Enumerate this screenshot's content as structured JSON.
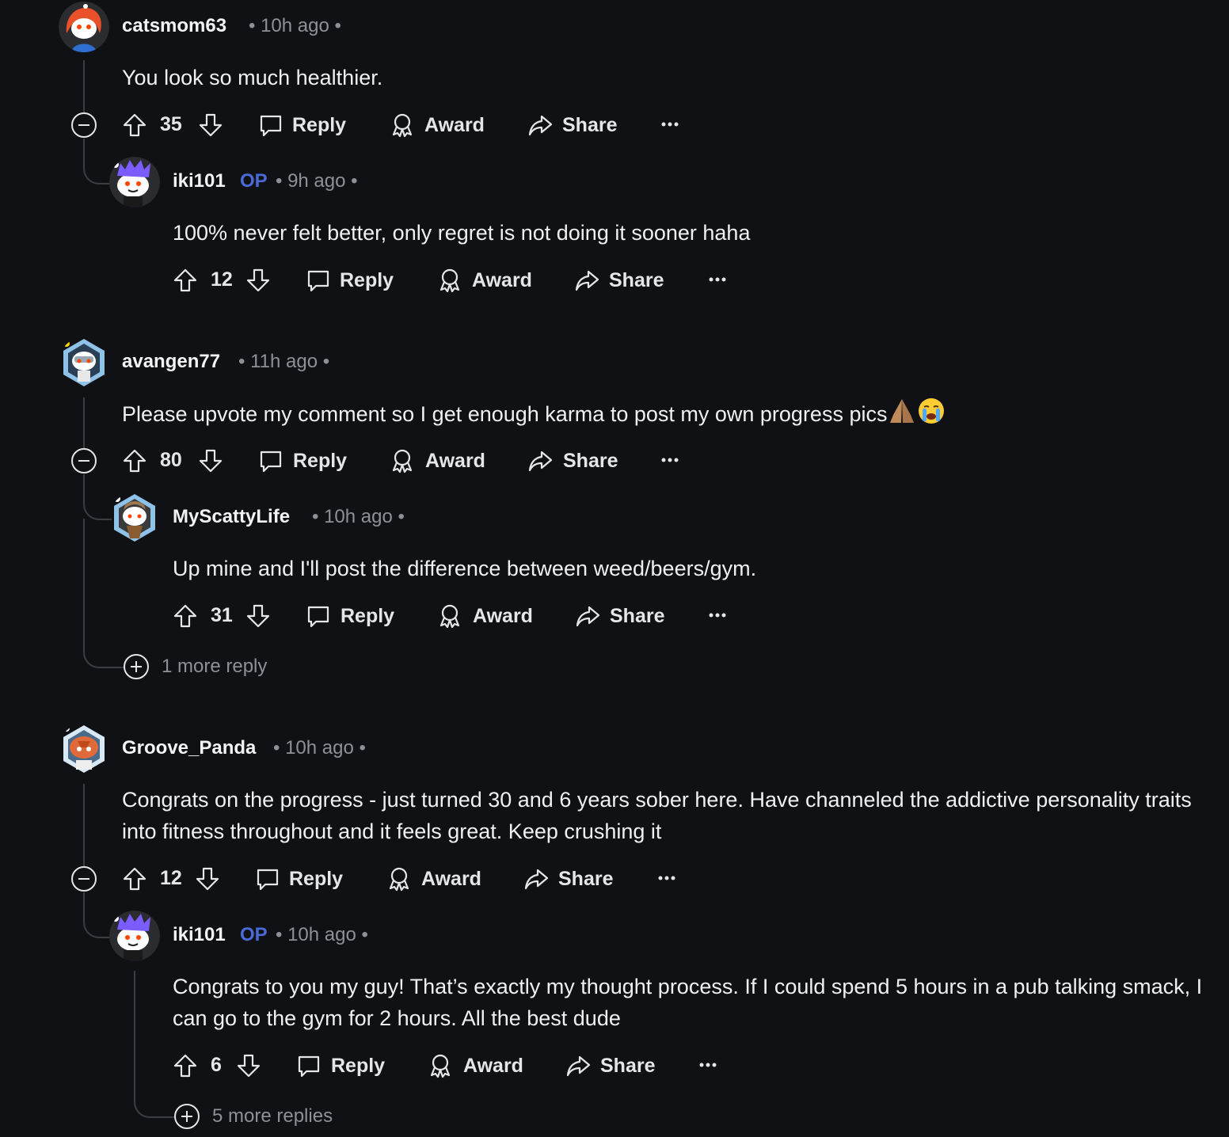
{
  "labels": {
    "reply": "Reply",
    "award": "Award",
    "share": "Share",
    "more": "···",
    "op_badge": "OP"
  },
  "colors": {
    "background": "#101114",
    "op_badge": "#4a6bd6",
    "meta_text": "#8d9196",
    "thread_line": "#3a3d42"
  },
  "comments": [
    {
      "username": "catsmom63",
      "time": "• 10h ago •",
      "body": "You look so much healthier.",
      "votes": "35",
      "replies": [
        {
          "username": "iki101",
          "op": true,
          "time": "• 9h ago •",
          "body": "100% never felt better, only regret is not doing it sooner haha",
          "votes": "12"
        }
      ]
    },
    {
      "username": "avangen77",
      "time": "• 11h ago •",
      "body": "Please upvote my comment so I get enough karma to post my own progress pics",
      "body_emoji": [
        "folded-hands-emoji",
        "crying-face-emoji"
      ],
      "votes": "80",
      "replies": [
        {
          "username": "MyScattyLife",
          "time": "• 10h ago •",
          "body": "Up mine and I'll post the difference between weed/beers/gym.",
          "votes": "31"
        }
      ],
      "more_replies": "1 more reply"
    },
    {
      "username": "Groove_Panda",
      "time": "• 10h ago •",
      "body": "Congrats on the progress - just turned 30 and 6 years sober here. Have channeled the addictive personality traits into fitness throughout and it feels great. Keep crushing it",
      "votes": "12",
      "replies": [
        {
          "username": "iki101",
          "op": true,
          "time": "• 10h ago •",
          "body": "Congrats to you my guy! That’s exactly my thought process. If I could spend 5 hours in a pub talking smack, I can go to the gym for 2 hours. All the best dude",
          "votes": "6",
          "more_replies": "5 more replies"
        }
      ]
    }
  ]
}
